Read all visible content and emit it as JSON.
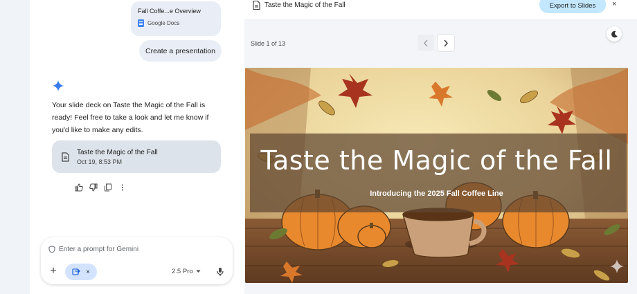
{
  "chat": {
    "doc_chip": {
      "title": "Fall Coffe...e Overview",
      "source": "Google Docs"
    },
    "user_message": "Create a presentation",
    "reply_text": "Your slide deck on Taste the Magic of the Fall is ready! Feel free to take a look and let me know if you'd like to make any edits.",
    "deck_card": {
      "title": "Taste the Magic of the Fall",
      "date": "Oct 19, 8:53 PM"
    },
    "actions": [
      "thumbs-up-icon",
      "thumbs-down-icon",
      "copy-icon",
      "more-icon"
    ]
  },
  "prompt": {
    "placeholder": "Enter a prompt for Gemini",
    "tool_close": "×",
    "model": "2.5 Pro",
    "add": "+"
  },
  "preview": {
    "title": "Taste the Magic of the Fall",
    "export_label": "Export to Slides",
    "close": "×",
    "slide_counter": "Slide 1 of 13",
    "slide": {
      "title": "Taste the Magic of the Fall",
      "subtitle": "Introducing the 2025 Fall Coffee Line"
    }
  },
  "colors": {
    "accent_blue": "#4285f4",
    "export_bg": "#c2e7ff",
    "chip_bg": "#e9eef6"
  }
}
